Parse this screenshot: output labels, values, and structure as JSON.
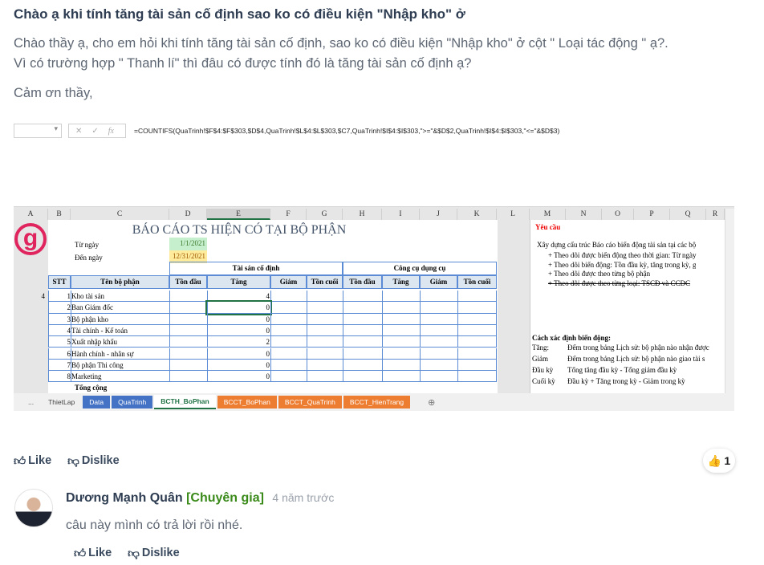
{
  "question": {
    "title": "Chào ạ khi tính tăng tài sản cố định sao ko có điều kiện \"Nhập kho\" ở",
    "body_lines": [
      "Chào thầy ạ, cho em hỏi khi tính tăng tài sản cố định, sao ko có điều kiện \"Nhập kho\" ở cột \" Loại tác động \" ạ?.",
      "Vì có trường hợp \" Thanh lí\" thì đâu có được tính đó là tăng tài sản cố định ạ?"
    ],
    "thanks": "Cảm ơn thầy,"
  },
  "excel": {
    "formula": "=COUNTIFS(QuaTrinh!$F$4:$F$303,$D$4,QuaTrinh!$L$4:$L$303,$C7,QuaTrinh!$I$4:$I$303,\">=\"&$D$2,QuaTrinh!$I$4:$I$303,\"<=\"&$D$3)",
    "fx": "fx",
    "columns": [
      "A",
      "B",
      "C",
      "D",
      "E",
      "F",
      "G",
      "H",
      "I",
      "J",
      "K",
      "L",
      "M",
      "N",
      "O",
      "P",
      "Q",
      "R"
    ],
    "report_title": "BÁO CÁO TS HIỆN CÓ TẠI BỘ PHẬN",
    "from_label": "Từ ngày",
    "from_value": "1/1/2021",
    "to_label": "Đến ngày",
    "to_value": "12/31/2021",
    "group_fixed": "Tài sản cố định",
    "group_tools": "Công cụ dụng cụ",
    "headers": [
      "STT",
      "Tên bộ phận",
      "Tồn đầu",
      "Tăng",
      "Giảm",
      "Tồn cuối",
      "Tồn đầu",
      "Tăng",
      "Giảm",
      "Tồn cuối"
    ],
    "row_marker": "4",
    "rows": [
      {
        "stt": "1",
        "name": "Kho tài sản",
        "tang": "4"
      },
      {
        "stt": "2",
        "name": "Ban Giám đốc",
        "tang": "0"
      },
      {
        "stt": "3",
        "name": "Bộ phận kho",
        "tang": "0"
      },
      {
        "stt": "4",
        "name": "Tài chính - Kế toán",
        "tang": "0"
      },
      {
        "stt": "5",
        "name": "Xuất nhập khẩu",
        "tang": "2"
      },
      {
        "stt": "6",
        "name": "Hành chính - nhân sự",
        "tang": "0"
      },
      {
        "stt": "7",
        "name": "Bộ phận Thi công",
        "tang": "0"
      },
      {
        "stt": "8",
        "name": "Marketing",
        "tang": "0"
      }
    ],
    "total_label": "Tổng cộng",
    "side": {
      "heading": "Yêu cầu",
      "intro": "Xây dựng cấu trúc Báo cáo biến động tài sản tại các bộ",
      "bullets": [
        "+ Theo dõi được biến động theo thời gian: Từ ngày",
        "+ Theo dõi biến động: Tồn đầu kỳ, tăng trong kỳ, g",
        "+ Theo dõi được theo từng bộ phận",
        "+ Theo dõi được theo từng loại: TSCĐ và CCDC"
      ],
      "method_heading": "Cách xác định biến động:",
      "methods": [
        {
          "k": "Tăng:",
          "v": "Đếm trong bảng Lịch sử: bộ phận nào nhận được"
        },
        {
          "k": "Giảm",
          "v": "Đếm trong bảng Lịch sử: bộ phận nào giao tài s"
        },
        {
          "k": "Đầu kỳ",
          "v": "Tổng tăng đầu kỳ - Tổng giảm đầu kỳ"
        },
        {
          "k": "Cuối kỳ",
          "v": "Đầu kỳ + Tăng trong kỳ - Giảm trong kỳ"
        }
      ]
    },
    "tabs": [
      {
        "label": "...",
        "color": "none"
      },
      {
        "label": "ThietLap",
        "color": "none"
      },
      {
        "label": "Data",
        "color": "#4472c4"
      },
      {
        "label": "QuaTrinh",
        "color": "#4472c4"
      },
      {
        "label": "BCTH_BoPhan",
        "color": "active"
      },
      {
        "label": "BCCT_BoPhan",
        "color": "#ed7d31"
      },
      {
        "label": "BCCT_QuaTrinh",
        "color": "#ed7d31"
      },
      {
        "label": "BCCT_HienTrang",
        "color": "#ed7d31"
      }
    ]
  },
  "actions": {
    "like": "Like",
    "dislike": "Dislike",
    "like_count": "1"
  },
  "reply": {
    "author": "Dương Mạnh Quân",
    "badge": "[Chuyên gia]",
    "time": "4 năm trước",
    "text": "câu này mình có trả lời rồi nhé.",
    "like": "Like",
    "dislike": "Dislike"
  }
}
